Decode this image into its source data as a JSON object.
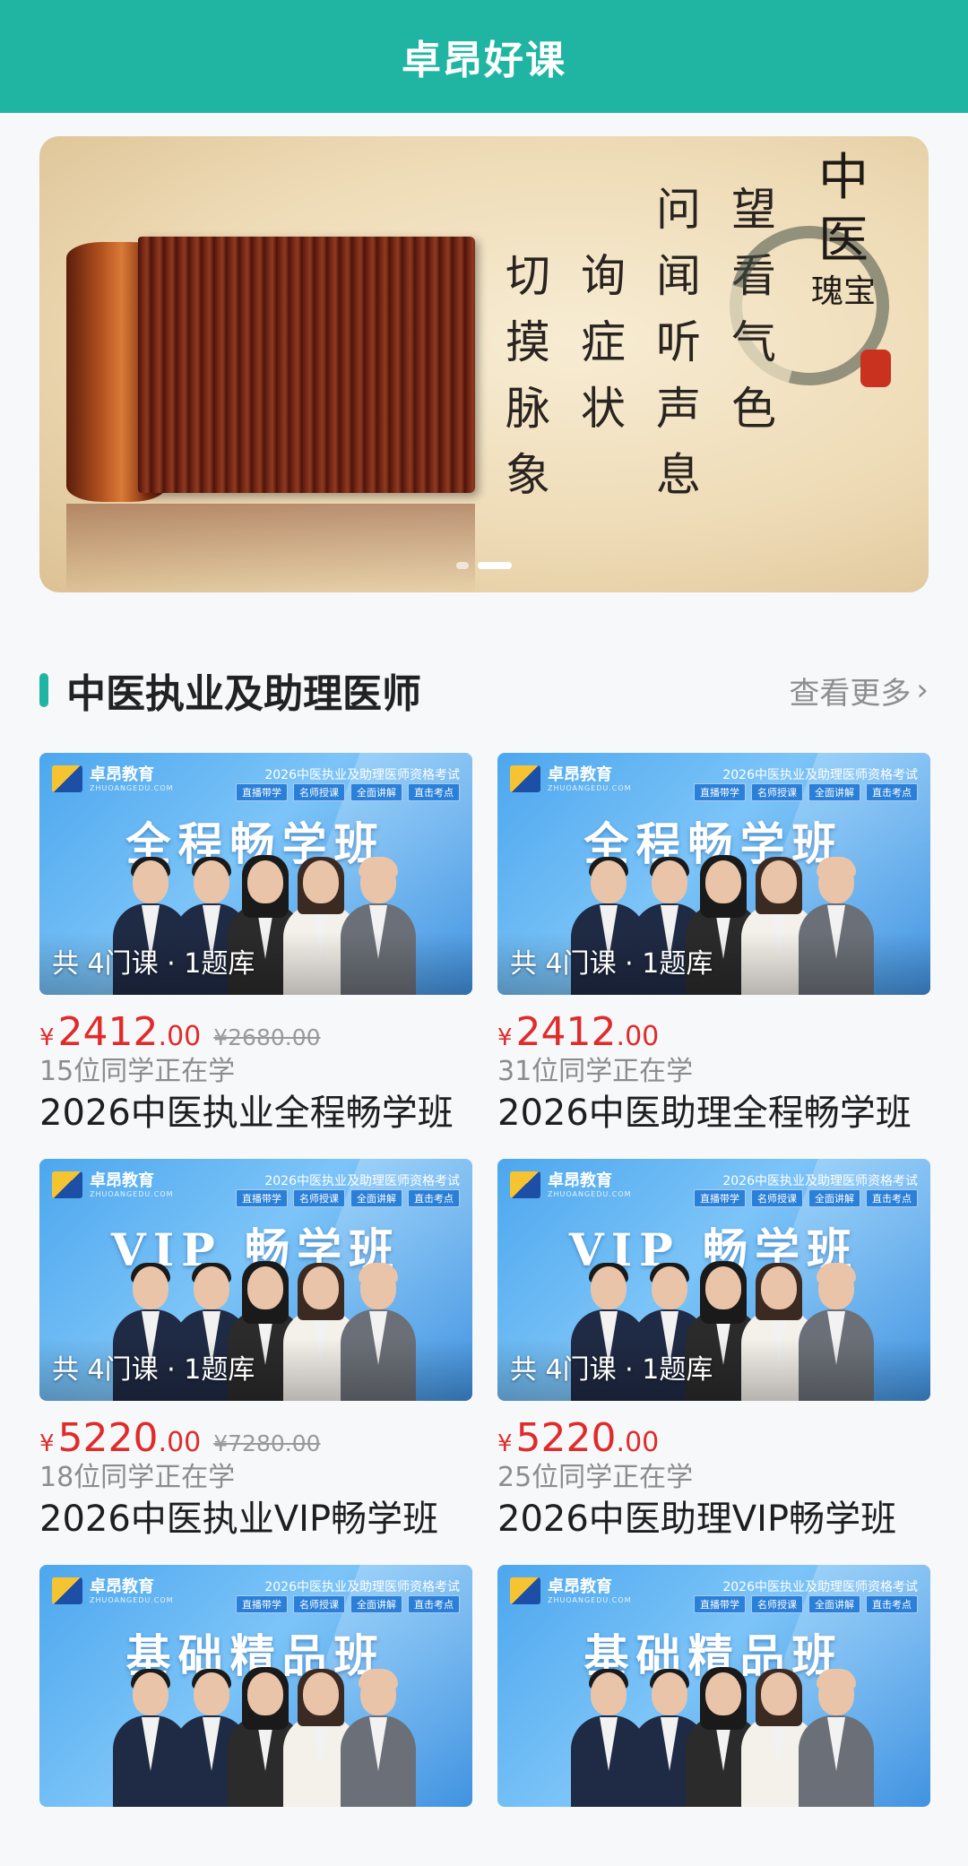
{
  "header": {
    "title": "卓昂好课"
  },
  "banner": {
    "calligraphy_columns": [
      [
        "望",
        "看",
        "气",
        "色"
      ],
      [
        "问",
        "闻",
        "听",
        "声",
        "息"
      ],
      [
        "询",
        "症",
        "状"
      ],
      [
        "切",
        "摸",
        "脉",
        "象"
      ]
    ],
    "seal_title": "中医",
    "seal_subtitle": "瑰宝",
    "dots": [
      false,
      true
    ]
  },
  "section": {
    "title": "中医执业及助理医师",
    "more_label": "查看更多"
  },
  "courses": [
    {
      "brand": "卓昂教育",
      "brand_sub": "ZHUOANGEDU.COM",
      "exam_title": "2026中医执业及助理医师资格考试",
      "tags": [
        "直播带学",
        "名师授课",
        "全面讲解",
        "直击考点"
      ],
      "class_name": "全程畅学班",
      "count": "共 4门课 · 1题库",
      "yen": "¥",
      "price_int": "2412",
      "price_dec": ".00",
      "original_price": "¥2680.00",
      "learners": "15位同学正在学",
      "title": "2026中医执业全程畅学班"
    },
    {
      "brand": "卓昂教育",
      "brand_sub": "ZHUOANGEDU.COM",
      "exam_title": "2026中医执业及助理医师资格考试",
      "tags": [
        "直播带学",
        "名师授课",
        "全面讲解",
        "直击考点"
      ],
      "class_name": "全程畅学班",
      "count": "共 4门课 · 1题库",
      "yen": "¥",
      "price_int": "2412",
      "price_dec": ".00",
      "original_price": "",
      "learners": "31位同学正在学",
      "title": "2026中医助理全程畅学班"
    },
    {
      "brand": "卓昂教育",
      "brand_sub": "ZHUOANGEDU.COM",
      "exam_title": "2026中医执业及助理医师资格考试",
      "tags": [
        "直播带学",
        "名师授课",
        "全面讲解",
        "直击考点"
      ],
      "class_name": "VIP 畅学班",
      "count": "共 4门课 · 1题库",
      "yen": "¥",
      "price_int": "5220",
      "price_dec": ".00",
      "original_price": "¥7280.00",
      "learners": "18位同学正在学",
      "title": "2026中医执业VIP畅学班"
    },
    {
      "brand": "卓昂教育",
      "brand_sub": "ZHUOANGEDU.COM",
      "exam_title": "2026中医执业及助理医师资格考试",
      "tags": [
        "直播带学",
        "名师授课",
        "全面讲解",
        "直击考点"
      ],
      "class_name": "VIP 畅学班",
      "count": "共 4门课 · 1题库",
      "yen": "¥",
      "price_int": "5220",
      "price_dec": ".00",
      "original_price": "",
      "learners": "25位同学正在学",
      "title": "2026中医助理VIP畅学班"
    },
    {
      "brand": "卓昂教育",
      "brand_sub": "ZHUOANGEDU.COM",
      "exam_title": "2026中医执业及助理医师资格考试",
      "tags": [
        "直播带学",
        "名师授课",
        "全面讲解",
        "直击考点"
      ],
      "class_name": "基础精品班",
      "count": "",
      "yen": "",
      "price_int": "",
      "price_dec": "",
      "original_price": "",
      "learners": "",
      "title": ""
    },
    {
      "brand": "卓昂教育",
      "brand_sub": "ZHUOANGEDU.COM",
      "exam_title": "2026中医执业及助理医师资格考试",
      "tags": [
        "直播带学",
        "名师授课",
        "全面讲解",
        "直击考点"
      ],
      "class_name": "基础精品班",
      "count": "",
      "yen": "",
      "price_int": "",
      "price_dec": "",
      "original_price": "",
      "learners": "",
      "title": ""
    }
  ],
  "colors": {
    "accent": "#20b5a2",
    "price": "#e02b2b"
  }
}
